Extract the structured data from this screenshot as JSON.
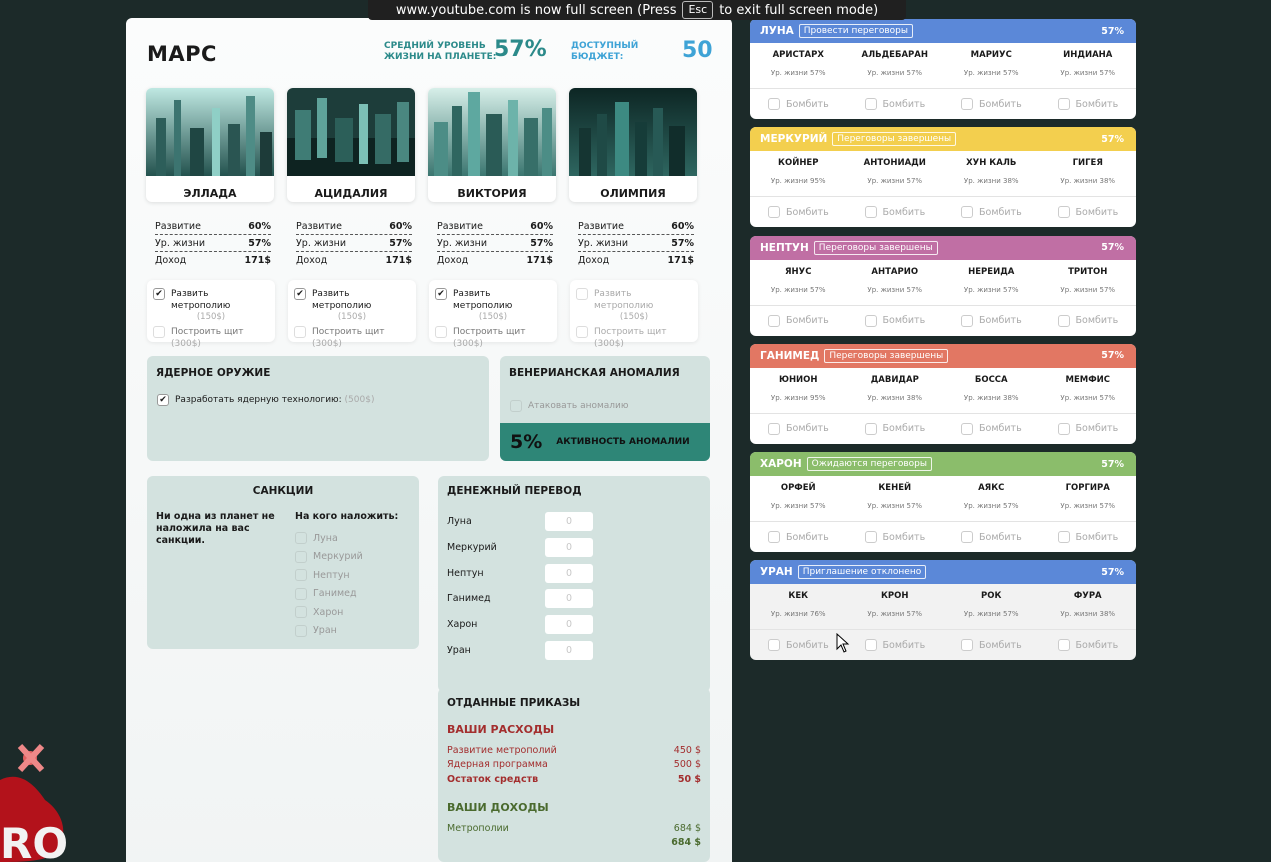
{
  "fullscreen_notice": {
    "text_before": "www.youtube.com is now full screen (Press",
    "key": "Esc",
    "text_after": "to exit full screen mode)"
  },
  "header": {
    "title": "МАРС",
    "life_label_1": "СРЕДНИЙ УРОВЕНЬ",
    "life_label_2": "ЖИЗНИ НА ПЛАНЕТЕ:",
    "life_value": "57%",
    "budget_label_1": "ДОСТУПНЫЙ",
    "budget_label_2": "БЮДЖЕТ:",
    "budget_value": "50"
  },
  "cities": [
    {
      "name": "ЭЛЛАДА",
      "dev_label": "Развитие",
      "dev": "60%",
      "life_label": "Ур. жизни",
      "life": "57%",
      "income_label": "Доход",
      "income": "171$",
      "metro_label": "Развить метрополию",
      "metro_cost": "(150$)",
      "metro_checked": true,
      "shield_label": "Построить щит",
      "shield_cost": "(300$)",
      "disabled": false
    },
    {
      "name": "АЦИДАЛИЯ",
      "dev_label": "Развитие",
      "dev": "60%",
      "life_label": "Ур. жизни",
      "life": "57%",
      "income_label": "Доход",
      "income": "171$",
      "metro_label": "Развить метрополию",
      "metro_cost": "(150$)",
      "metro_checked": true,
      "shield_label": "Построить щит",
      "shield_cost": "(300$)",
      "disabled": false
    },
    {
      "name": "ВИКТОРИЯ",
      "dev_label": "Развитие",
      "dev": "60%",
      "life_label": "Ур. жизни",
      "life": "57%",
      "income_label": "Доход",
      "income": "171$",
      "metro_label": "Развить метрополию",
      "metro_cost": "(150$)",
      "metro_checked": true,
      "shield_label": "Построить щит",
      "shield_cost": "(300$)",
      "disabled": false
    },
    {
      "name": "ОЛИМПИЯ",
      "dev_label": "Развитие",
      "dev": "60%",
      "life_label": "Ур. жизни",
      "life": "57%",
      "income_label": "Доход",
      "income": "171$",
      "metro_label": "Развить метрополию",
      "metro_cost": "(150$)",
      "metro_checked": false,
      "shield_label": "Построить щит",
      "shield_cost": "(300$)",
      "disabled": true
    }
  ],
  "nuclear": {
    "title": "ЯДЕРНОЕ ОРУЖИЕ",
    "option": "Разработать ядерную технологию:",
    "cost": "(500$)"
  },
  "anomaly": {
    "title": "ВЕНЕРИАНСКАЯ АНОМАЛИЯ",
    "option": "Атаковать аномалию",
    "pct": "5%",
    "pct_label": "АКТИВНОСТЬ АНОМАЛИИ"
  },
  "sanctions": {
    "title": "САНКЦИИ",
    "status": "Ни одна из планет не наложила на вас санкции.",
    "apply_label": "На кого наложить:",
    "targets": [
      "Луна",
      "Меркурий",
      "Нептун",
      "Ганимед",
      "Харон",
      "Уран"
    ]
  },
  "transfer": {
    "title": "ДЕНЕЖНЫЙ ПЕРЕВОД",
    "rows": [
      {
        "name": "Луна",
        "placeholder": "0"
      },
      {
        "name": "Меркурий",
        "placeholder": "0"
      },
      {
        "name": "Нептун",
        "placeholder": "0"
      },
      {
        "name": "Ганимед",
        "placeholder": "0"
      },
      {
        "name": "Харон",
        "placeholder": "0"
      },
      {
        "name": "Уран",
        "placeholder": "0"
      }
    ]
  },
  "orders": {
    "title": "ОТДАННЫЕ ПРИКАЗЫ",
    "expenses_title": "ВАШИ РАСХОДЫ",
    "expenses": [
      {
        "label": "Развитие метрополий",
        "value": "450 $",
        "bold": false
      },
      {
        "label": "Ядерная программа",
        "value": "500 $",
        "bold": false
      },
      {
        "label": "Остаток средств",
        "value": "50 $",
        "bold": true
      }
    ],
    "income_title": "ВАШИ ДОХОДЫ",
    "income": [
      {
        "label": "Метрополии",
        "value": "684 $",
        "bold": false
      },
      {
        "label": "",
        "value": "684 $",
        "bold": true
      }
    ]
  },
  "planets": [
    {
      "name": "ЛУНА",
      "status": "Провести переговоры",
      "pct": "57%",
      "color": "#5b88d8",
      "dim": false,
      "cities": [
        {
          "name": "АРИСТАРХ",
          "life": "Ур. жизни 57%"
        },
        {
          "name": "АЛЬДЕБАРАН",
          "life": "Ур. жизни 57%"
        },
        {
          "name": "МАРИУС",
          "life": "Ур. жизни 57%"
        },
        {
          "name": "ИНДИАНА",
          "life": "Ур. жизни 57%"
        }
      ]
    },
    {
      "name": "МЕРКУРИЙ",
      "status": "Переговоры завершены",
      "pct": "57%",
      "color": "#f3cf4e",
      "dim": false,
      "cities": [
        {
          "name": "КОЙНЕР",
          "life": "Ур. жизни 95%"
        },
        {
          "name": "АНТОНИАДИ",
          "life": "Ур. жизни 57%"
        },
        {
          "name": "ХУН КАЛЬ",
          "life": "Ур. жизни 38%"
        },
        {
          "name": "ГИГЕЯ",
          "life": "Ур. жизни 38%"
        }
      ]
    },
    {
      "name": "НЕПТУН",
      "status": "Переговоры завершены",
      "pct": "57%",
      "color": "#c06fa4",
      "dim": false,
      "cities": [
        {
          "name": "ЯНУС",
          "life": "Ур. жизни 57%"
        },
        {
          "name": "АНТАРИО",
          "life": "Ур. жизни 57%"
        },
        {
          "name": "НЕРЕИДА",
          "life": "Ур. жизни 57%"
        },
        {
          "name": "ТРИТОН",
          "life": "Ур. жизни 57%"
        }
      ]
    },
    {
      "name": "ГАНИМЕД",
      "status": "Переговоры завершены",
      "pct": "57%",
      "color": "#e27763",
      "dim": false,
      "cities": [
        {
          "name": "ЮНИОН",
          "life": "Ур. жизни 95%"
        },
        {
          "name": "ДАВИДАР",
          "life": "Ур. жизни 38%"
        },
        {
          "name": "БОССА",
          "life": "Ур. жизни 38%"
        },
        {
          "name": "МЕМФИС",
          "life": "Ур. жизни 57%"
        }
      ]
    },
    {
      "name": "ХАРОН",
      "status": "Ожидаются переговоры",
      "pct": "57%",
      "color": "#8bbd6b",
      "dim": false,
      "cities": [
        {
          "name": "ОРФЕЙ",
          "life": "Ур. жизни 57%"
        },
        {
          "name": "КЕНЕЙ",
          "life": "Ур. жизни 57%"
        },
        {
          "name": "АЯКС",
          "life": "Ур. жизни 57%"
        },
        {
          "name": "ГОРГИРА",
          "life": "Ур. жизни 57%"
        }
      ]
    },
    {
      "name": "УРАН",
      "status": "Приглашение отклонено",
      "pct": "57%",
      "color": "#5b88d8",
      "dim": true,
      "cities": [
        {
          "name": "КЕК",
          "life": "Ур. жизни 76%"
        },
        {
          "name": "КРОН",
          "life": "Ур. жизни 57%"
        },
        {
          "name": "РОК",
          "life": "Ур. жизни 57%"
        },
        {
          "name": "ФУРА",
          "life": "Ур. жизни 38%"
        }
      ]
    }
  ],
  "bomb_label": "Бомбить",
  "colors": {
    "teal": "#2b8a8a",
    "budget_blue": "#3ea3d6",
    "panel_green": "#d3e2df",
    "anomaly_green": "#2e8677",
    "expense_red": "#a32e2e",
    "income_green": "#4a6a2e"
  }
}
